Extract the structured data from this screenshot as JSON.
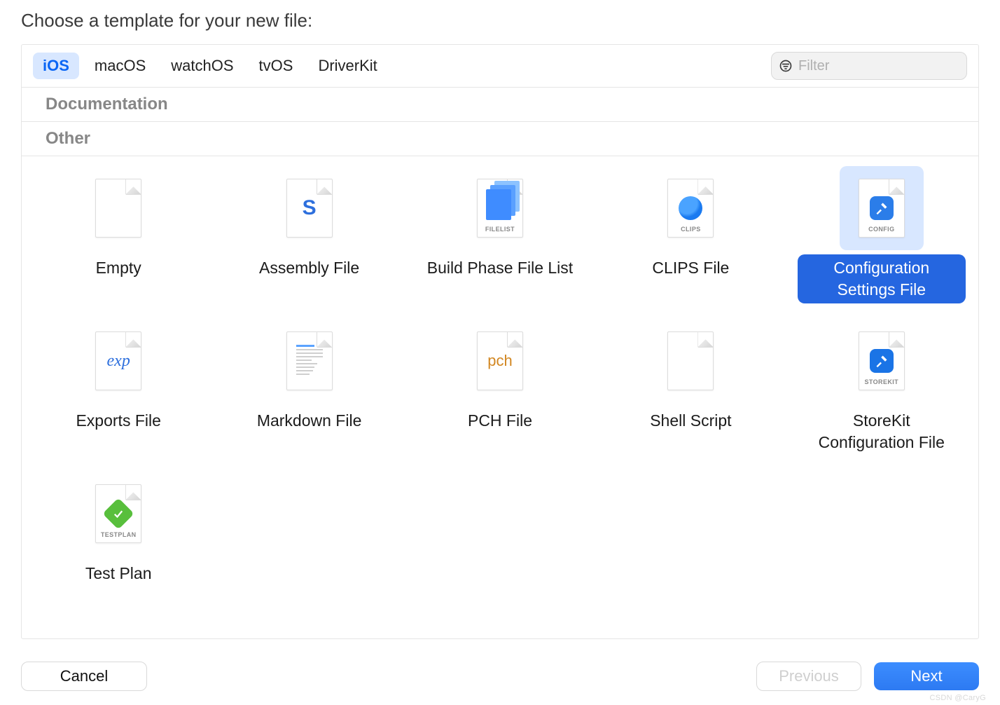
{
  "title": "Choose a template for your new file:",
  "tabs": [
    "iOS",
    "macOS",
    "watchOS",
    "tvOS",
    "DriverKit"
  ],
  "active_tab_index": 0,
  "filter": {
    "placeholder": "Filter",
    "value": ""
  },
  "sections": {
    "doc_header": "Documentation",
    "other_header": "Other"
  },
  "items": {
    "empty": {
      "label": "Empty"
    },
    "assembly": {
      "label": "Assembly File",
      "mark": "S"
    },
    "filelist": {
      "label": "Build Phase File List",
      "badge": "FILELIST"
    },
    "clips": {
      "label": "CLIPS File",
      "badge": "CLIPS"
    },
    "config": {
      "label": "Configuration Settings File",
      "badge": "CONFIG"
    },
    "exports": {
      "label": "Exports File",
      "mark": "exp"
    },
    "markdown": {
      "label": "Markdown File"
    },
    "pch": {
      "label": "PCH File",
      "mark": "pch"
    },
    "shell": {
      "label": "Shell Script"
    },
    "storekit": {
      "label": "StoreKit Configuration File",
      "badge": "STOREKIT"
    },
    "testplan": {
      "label": "Test Plan",
      "badge": "TESTPLAN"
    }
  },
  "selected_item": "config",
  "buttons": {
    "cancel": "Cancel",
    "previous": "Previous",
    "next": "Next"
  },
  "watermark": "CSDN @CaryG"
}
